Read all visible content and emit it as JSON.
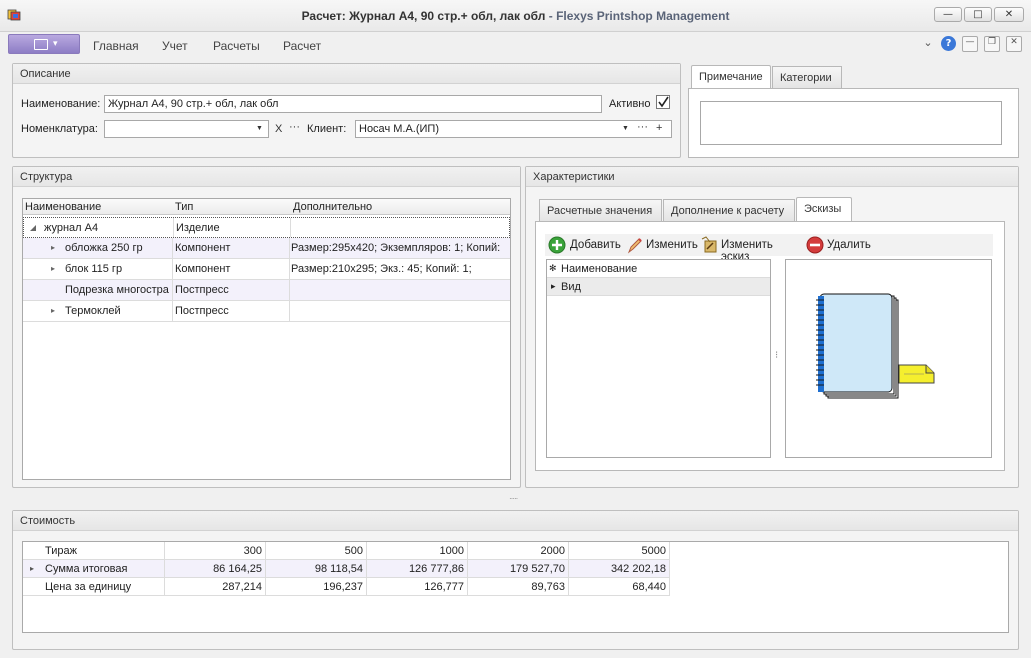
{
  "window": {
    "title_main": "Расчет: Журнал А4, 90 стр.+ обл, лак обл",
    "title_sep": " - ",
    "title_app": "Flexys Printshop Management",
    "btn_min": "—",
    "btn_max": "□",
    "btn_close": "✕"
  },
  "menu": {
    "items": [
      "Главная",
      "Учет",
      "Расчеты",
      "Расчет"
    ],
    "collapse_glyph": "⌄",
    "help_glyph": "?",
    "mdi_min": "—",
    "mdi_restore": "❐",
    "mdi_close": "✕"
  },
  "description": {
    "header": "Описание",
    "name_label": "Наименование:",
    "name_value": "Журнал А4, 90 стр.+ обл, лак обл",
    "active_label": "Активно",
    "active_checked": true,
    "nomenclature_label": "Номенклатура:",
    "nomenclature_value": "",
    "clear_glyph": "X",
    "ellipsis": "···",
    "client_label": "Клиент:",
    "client_value": "Носач М.А.(ИП)",
    "add_glyph": "+"
  },
  "notes": {
    "tabs": [
      "Примечание",
      "Категории"
    ],
    "active_tab": 0,
    "text": ""
  },
  "structure": {
    "header": "Структура",
    "columns": [
      "Наименование",
      "Тип",
      "Дополнительно"
    ],
    "rows": [
      {
        "expander": "◢",
        "name": "журнал А4",
        "type": "Изделие",
        "extra": ""
      },
      {
        "expander": "▸",
        "name": "обложка 250 гр",
        "type": "Компонент",
        "extra": "Размер:295x420; Экземпляров: 1; Копий:"
      },
      {
        "expander": "▸",
        "name": "блок 115 гр",
        "type": "Компонент",
        "extra": "Размер:210x295; Экз.: 45; Копий: 1;"
      },
      {
        "expander": "",
        "name": "Подрезка многостра",
        "type": "Постпресс",
        "extra": ""
      },
      {
        "expander": "▸",
        "name": "Термоклей",
        "type": "Постпресс",
        "extra": ""
      }
    ]
  },
  "characteristics": {
    "header": "Характеристики",
    "tabs": [
      "Расчетные значения",
      "Дополнение к расчету",
      "Эскизы"
    ],
    "active_tab": 2,
    "toolbar": {
      "add": "Добавить",
      "edit": "Изменить",
      "edit_sketch": "Изменить эскиз",
      "delete": "Удалить"
    },
    "list_rows": [
      {
        "marker": "✻",
        "label": "Наименование"
      },
      {
        "marker": "▸",
        "label": "Вид"
      }
    ],
    "splitter_glyph": "⁝"
  },
  "cost": {
    "header": "Стоимость",
    "columns": [
      "Тираж",
      "300",
      "500",
      "1000",
      "2000",
      "5000"
    ],
    "rows": [
      {
        "marker": "▸",
        "label": "Сумма итоговая",
        "values": [
          "86 164,25",
          "98 118,54",
          "126 777,86",
          "179 527,70",
          "342 202,18"
        ]
      },
      {
        "marker": "",
        "label": "Цена за единицу",
        "values": [
          "287,214",
          "196,237",
          "126,777",
          "89,763",
          "68,440"
        ]
      }
    ]
  },
  "colors": {
    "accent_purple": "#9b8bd0",
    "row_alt": "#f3f1fb",
    "add_green": "#3aa33a",
    "delete_red": "#d43c3c",
    "sketch_blue": "#cfe8f8",
    "sticker_yellow": "#f5ef2e"
  }
}
